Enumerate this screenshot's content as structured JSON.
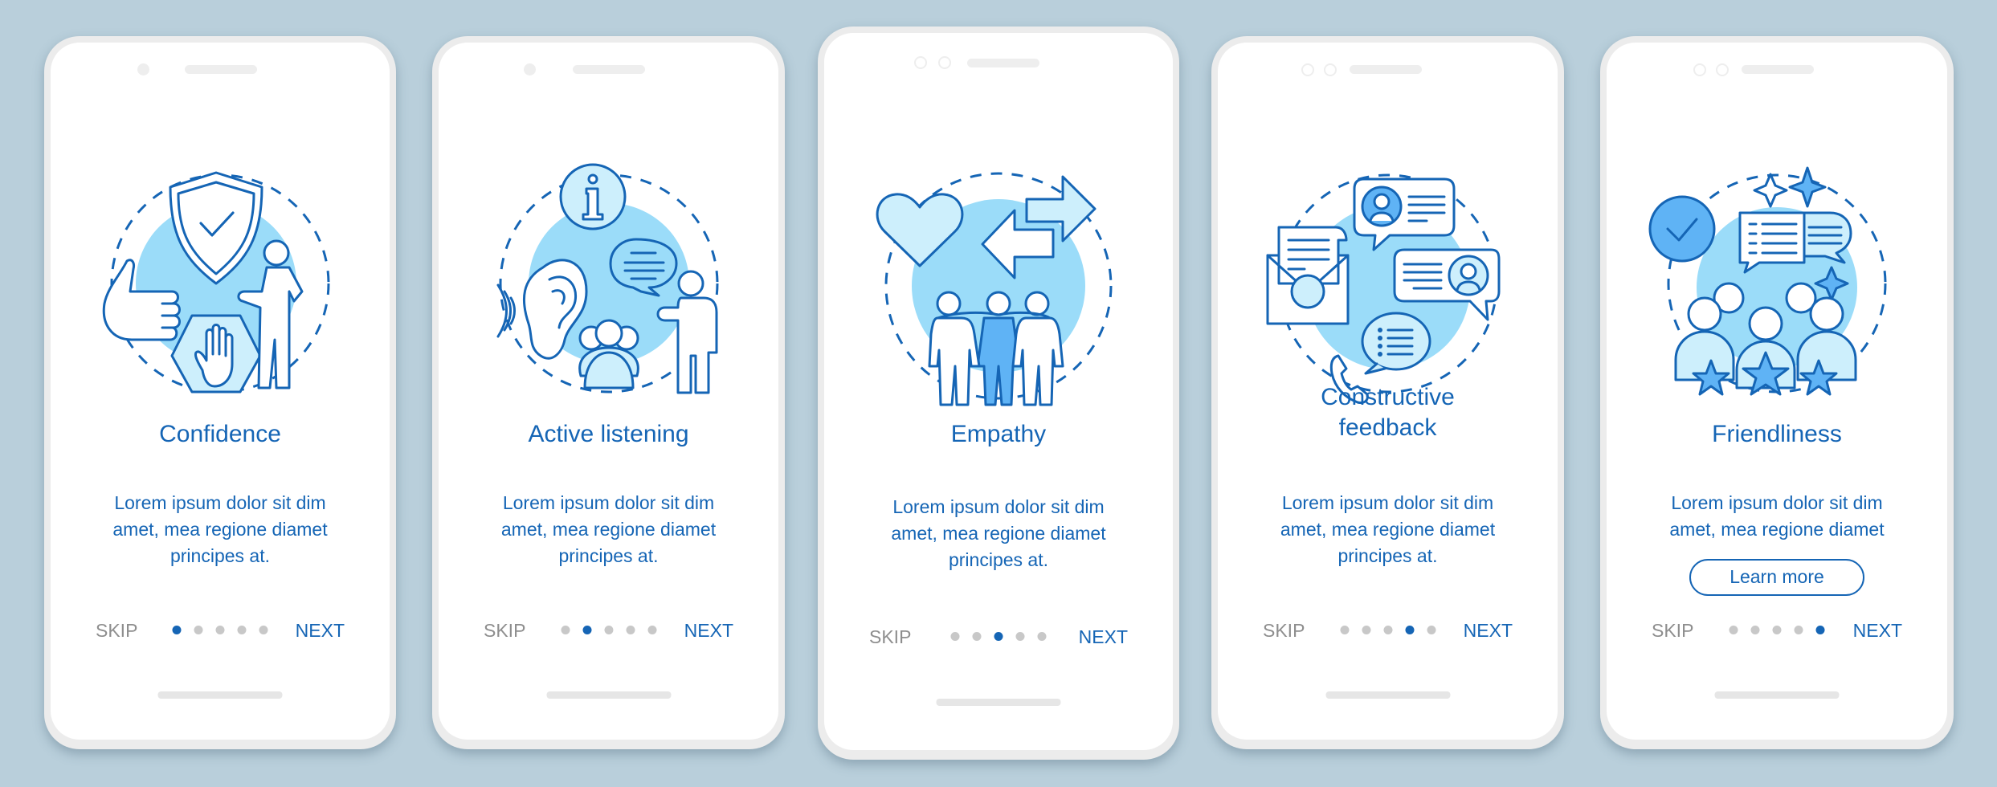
{
  "colors": {
    "background": "#b9cfdb",
    "accent": "#1565b5",
    "illustration_fill": "#9bdcf9",
    "dot_inactive": "#c8c8c8",
    "skip_text": "#8e8e8e"
  },
  "screens": [
    {
      "title": "Confidence",
      "body": [
        "Lorem ipsum dolor sit dim",
        "amet, mea regione diamet",
        "principes at."
      ],
      "illustration": "confidence-illustration",
      "skip_label": "SKIP",
      "next_label": "NEXT",
      "page_index": 1,
      "page_count": 5
    },
    {
      "title": "Active listening",
      "body": [
        "Lorem ipsum dolor sit dim",
        "amet, mea regione diamet",
        "principes at."
      ],
      "illustration": "active-listening-illustration",
      "skip_label": "SKIP",
      "next_label": "NEXT",
      "page_index": 2,
      "page_count": 5
    },
    {
      "title": "Empathy",
      "body": [
        "Lorem ipsum dolor sit dim",
        "amet, mea regione diamet",
        "principes at."
      ],
      "illustration": "empathy-illustration",
      "skip_label": "SKIP",
      "next_label": "NEXT",
      "page_index": 3,
      "page_count": 5
    },
    {
      "title_lines": [
        "Constructive",
        "feedback"
      ],
      "body": [
        "Lorem ipsum dolor sit dim",
        "amet, mea regione diamet",
        "principes at."
      ],
      "illustration": "constructive-feedback-illustration",
      "skip_label": "SKIP",
      "next_label": "NEXT",
      "page_index": 4,
      "page_count": 5
    },
    {
      "title": "Friendliness",
      "body": [
        "Lorem ipsum dolor sit dim",
        "amet, mea regione diamet"
      ],
      "illustration": "friendliness-illustration",
      "button_label": "Learn more",
      "skip_label": "SKIP",
      "next_label": "NEXT",
      "page_index": 5,
      "page_count": 5
    }
  ]
}
